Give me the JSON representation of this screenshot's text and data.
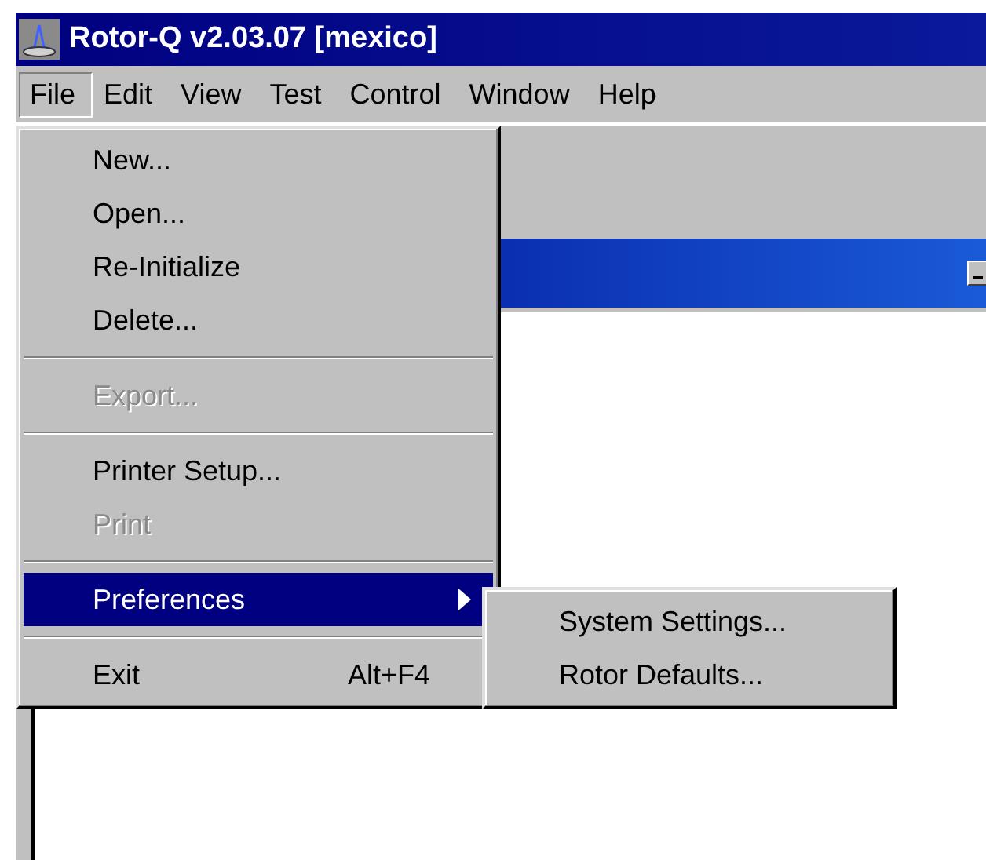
{
  "window": {
    "title": "Rotor-Q v2.03.07 [mexico]"
  },
  "menu_bar": [
    {
      "label": "File",
      "selected": true
    },
    {
      "label": "Edit",
      "selected": false
    },
    {
      "label": "View",
      "selected": false
    },
    {
      "label": "Test",
      "selected": false
    },
    {
      "label": "Control",
      "selected": false
    },
    {
      "label": "Window",
      "selected": false
    },
    {
      "label": "Help",
      "selected": false
    }
  ],
  "file_menu": [
    {
      "kind": "item",
      "label": "New...",
      "disabled": false,
      "selected": false
    },
    {
      "kind": "item",
      "label": "Open...",
      "disabled": false,
      "selected": false
    },
    {
      "kind": "item",
      "label": "Re-Initialize",
      "disabled": false,
      "selected": false
    },
    {
      "kind": "item",
      "label": "Delete...",
      "disabled": false,
      "selected": false
    },
    {
      "kind": "separator"
    },
    {
      "kind": "item",
      "label": "Export...",
      "disabled": true,
      "selected": false
    },
    {
      "kind": "separator"
    },
    {
      "kind": "item",
      "label": "Printer Setup...",
      "disabled": false,
      "selected": false
    },
    {
      "kind": "item",
      "label": "Print",
      "disabled": true,
      "selected": false
    },
    {
      "kind": "separator"
    },
    {
      "kind": "item",
      "label": "Preferences",
      "disabled": false,
      "selected": true,
      "submenu": true
    },
    {
      "kind": "separator"
    },
    {
      "kind": "item",
      "label": "Exit",
      "shortcut": "Alt+F4",
      "disabled": false,
      "selected": false
    }
  ],
  "submenu": [
    {
      "kind": "item",
      "label": "System Settings...",
      "disabled": false,
      "selected": false
    },
    {
      "kind": "item",
      "label": "Rotor Defaults...",
      "disabled": false,
      "selected": false
    }
  ]
}
